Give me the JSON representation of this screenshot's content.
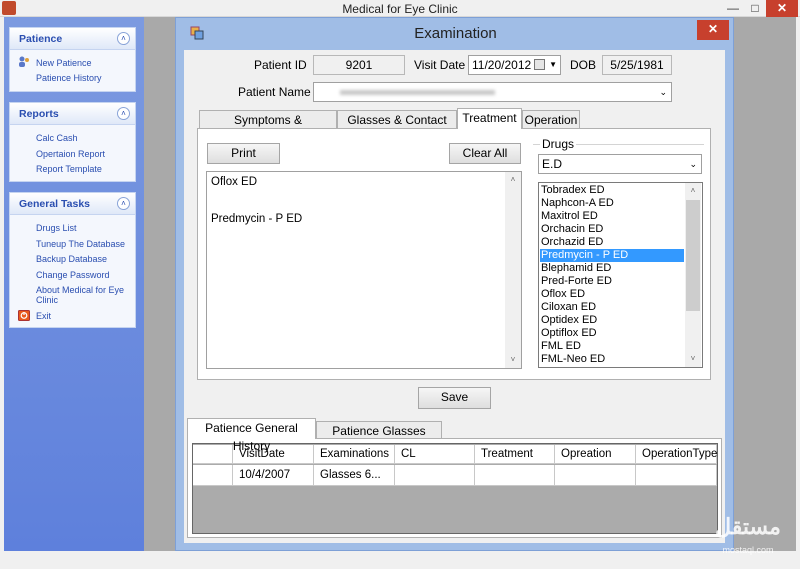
{
  "app": {
    "title": "Medical for Eye Clinic",
    "min_icon": "minimize-icon",
    "max_icon": "maximize-icon",
    "close_icon": "close-icon"
  },
  "sidebar": {
    "panels": [
      {
        "title": "Patience",
        "items": [
          "New Patience",
          "Patience History"
        ]
      },
      {
        "title": "Reports",
        "items": [
          "Calc Cash",
          "Opertaion Report",
          "Report Template"
        ]
      },
      {
        "title": "General Tasks",
        "items": [
          "Drugs List",
          "Tuneup The Database",
          "Backup Database",
          "Change Password",
          "About Medical for Eye Clinic",
          "Exit"
        ]
      }
    ]
  },
  "exam": {
    "title": "Examination",
    "patient_id_label": "Patient ID",
    "patient_id": "9201",
    "visit_date_label": "Visit Date",
    "visit_date": "11/20/2012",
    "dob_label": "DOB",
    "dob": "5/25/1981",
    "patient_name_label": "Patient Name",
    "tabs": [
      "Symptoms & Examinations",
      "Glasses & Contact Lens",
      "Treatment",
      "Operation"
    ],
    "print_label": "Print",
    "clear_all_label": "Clear All",
    "prescriptions": [
      "Oflox   ED",
      "Predmycin - P   ED"
    ],
    "drugs_label": "Drugs",
    "drug_form": "E.D",
    "drugs": [
      "Tobradex   ED",
      "Naphcon-A   ED",
      "Maxitrol   ED",
      "Orchacin   ED",
      "Orchazid   ED",
      "Predmycin - P   ED",
      "Blephamid   ED",
      "Pred-Forte   ED",
      "Oflox   ED",
      "Ciloxan   ED",
      "Optidex   ED",
      "Optiflox   ED",
      "FML   ED",
      "FML-Neo   ED"
    ],
    "selected_drug_index": 5,
    "save_label": "Save"
  },
  "history": {
    "tabs": [
      "Patience General History",
      "Patience Glasses History"
    ],
    "columns": [
      "VisitDate",
      "Examinations",
      "CL",
      "Treatment",
      "Opreation",
      "OperationType"
    ],
    "rows": [
      [
        "10/4/2007",
        "Glasses    6...",
        "",
        "",
        "",
        ""
      ]
    ]
  },
  "watermark": {
    "text": "مستقل",
    "sub": "mostaql.com"
  },
  "colors": {
    "sidebar": "#6c8ce0",
    "mdi": "#a9a9a9",
    "selection": "#3399ff",
    "close": "#c7402d"
  }
}
